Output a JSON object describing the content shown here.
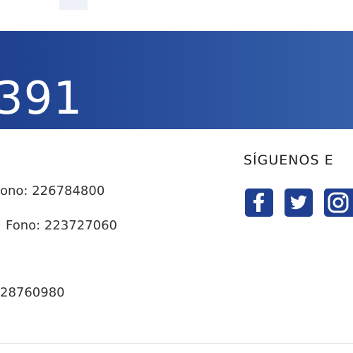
{
  "banner": {
    "number_fragment": "391"
  },
  "contact": {
    "line_1": "ono: 226784800",
    "line_2": "Fono: 223727060",
    "line_3": "28760980"
  },
  "social": {
    "title": "SÍGUENOS E",
    "icons": [
      "facebook-icon",
      "twitter-icon",
      "instagram-icon"
    ],
    "icon_color": "#1f3f91"
  },
  "colors": {
    "banner_start": "#1f418f",
    "banner_end": "#3560a8",
    "text": "#333333"
  }
}
